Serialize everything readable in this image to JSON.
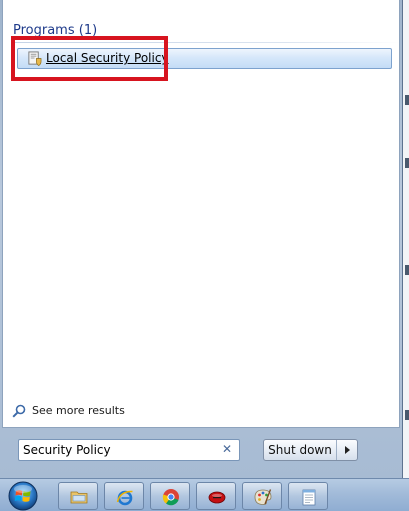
{
  "search_results": {
    "section_header": "Programs (1)",
    "items": [
      {
        "label": "Local Security Policy",
        "icon": "security-policy-icon"
      }
    ]
  },
  "see_more": {
    "label": "See more results",
    "icon": "search-icon"
  },
  "search": {
    "value": "Security Policy",
    "clear_icon": "close-icon"
  },
  "power": {
    "shutdown_label": "Shut down",
    "arrow_icon": "chevron-right-icon"
  },
  "taskbar": {
    "items": [
      {
        "name": "file-explorer",
        "icon": "folder-icon"
      },
      {
        "name": "internet-explorer",
        "icon": "internet-explorer-icon"
      },
      {
        "name": "chrome",
        "icon": "chrome-icon"
      },
      {
        "name": "app-red",
        "icon": "red-disc-icon"
      },
      {
        "name": "paint",
        "icon": "paint-palette-icon"
      },
      {
        "name": "notepad",
        "icon": "notepad-icon"
      }
    ]
  },
  "colors": {
    "highlight_border": "#d7141f",
    "section_header": "#1e3a8a",
    "selection": "#c4dcf6"
  }
}
